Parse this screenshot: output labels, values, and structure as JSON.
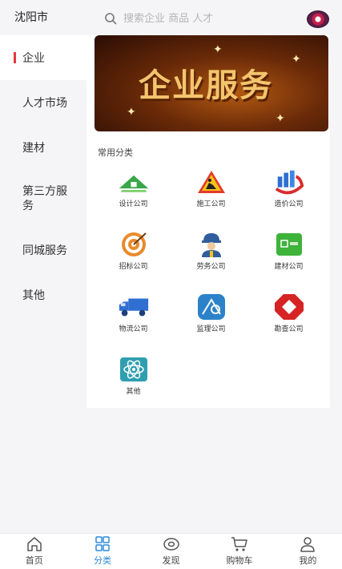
{
  "header": {
    "city": "沈阳市",
    "search_placeholder": "搜索企业 商品 人才"
  },
  "sidebar": {
    "items": [
      {
        "label": "企业",
        "active": true
      },
      {
        "label": "人才市场"
      },
      {
        "label": "建材"
      },
      {
        "label": "第三方服务"
      },
      {
        "label": "同城服务"
      },
      {
        "label": "其他"
      }
    ]
  },
  "banner": {
    "title": "企业服务"
  },
  "section": {
    "title": "常用分类"
  },
  "categories": [
    {
      "label": "设计公司",
      "icon": "house-icon"
    },
    {
      "label": "施工公司",
      "icon": "construction-sign-icon"
    },
    {
      "label": "造价公司",
      "icon": "building-chart-icon"
    },
    {
      "label": "招标公司",
      "icon": "target-icon"
    },
    {
      "label": "劳务公司",
      "icon": "worker-icon"
    },
    {
      "label": "建材公司",
      "icon": "material-icon"
    },
    {
      "label": "物流公司",
      "icon": "truck-icon"
    },
    {
      "label": "监理公司",
      "icon": "supervision-icon"
    },
    {
      "label": "勘查公司",
      "icon": "survey-icon"
    },
    {
      "label": "其他",
      "icon": "atom-icon"
    }
  ],
  "tabbar": {
    "items": [
      {
        "label": "首页",
        "icon": "home-icon"
      },
      {
        "label": "分类",
        "icon": "grid-icon",
        "active": true
      },
      {
        "label": "发现",
        "icon": "eye-icon"
      },
      {
        "label": "购物车",
        "icon": "cart-icon"
      },
      {
        "label": "我的",
        "icon": "user-icon"
      }
    ]
  },
  "colors": {
    "accent": "#2b8ad8",
    "active_marker": "#e4393c"
  }
}
